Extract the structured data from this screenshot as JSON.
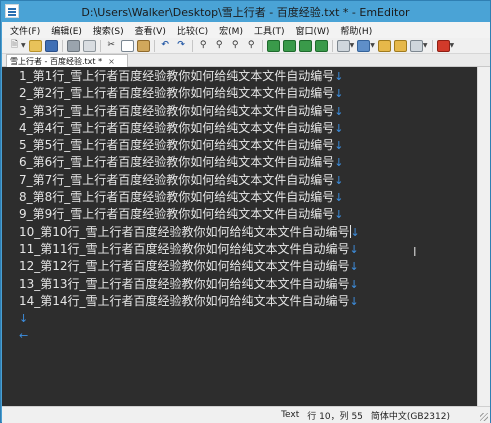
{
  "window": {
    "title": "D:\\Users\\Walker\\Desktop\\雪上行者 - 百度经验.txt * - EmEditor"
  },
  "menu": [
    {
      "label": "文件(F)"
    },
    {
      "label": "编辑(E)"
    },
    {
      "label": "搜索(S)"
    },
    {
      "label": "查看(V)"
    },
    {
      "label": "比较(C)"
    },
    {
      "label": "宏(M)"
    },
    {
      "label": "工具(T)"
    },
    {
      "label": "窗口(W)"
    },
    {
      "label": "帮助(H)"
    }
  ],
  "toolbar": {
    "icons": [
      "new-file-icon",
      "open-folder-icon",
      "save-icon",
      "print-icon",
      "print-preview-icon",
      "cut-icon",
      "copy-icon",
      "paste-icon",
      "undo-icon",
      "redo-icon",
      "find-icon",
      "find-next-icon",
      "find-prev-icon",
      "replace-icon",
      "wrap-icon",
      "view-icon",
      "outline-icon",
      "grid-icon",
      "clipboard-icon",
      "macro-icon",
      "tools-icon",
      "customize-icon",
      "stop-icon"
    ]
  },
  "tab": {
    "label": "雪上行者 - 百度经验.txt *",
    "close": "×"
  },
  "editor": {
    "eol_mark": "↓",
    "eof_mark": "←",
    "lines": [
      "1_第1行_雪上行者百度经验教你如何给纯文本文件自动编号",
      "2_第2行_雪上行者百度经验教你如何给纯文本文件自动编号",
      "3_第3行_雪上行者百度经验教你如何给纯文本文件自动编号",
      "4_第4行_雪上行者百度经验教你如何给纯文本文件自动编号",
      "5_第5行_雪上行者百度经验教你如何给纯文本文件自动编号",
      "6_第6行_雪上行者百度经验教你如何给纯文本文件自动编号",
      "7_第7行_雪上行者百度经验教你如何给纯文本文件自动编号",
      "8_第8行_雪上行者百度经验教你如何给纯文本文件自动编号",
      "9_第9行_雪上行者百度经验教你如何给纯文本文件自动编号",
      "10_第10行_雪上行者百度经验教你如何给纯文本文件自动编号",
      "11_第11行_雪上行者百度经验教你如何给纯文本文件自动编号",
      "12_第12行_雪上行者百度经验教你如何给纯文本文件自动编号",
      "13_第13行_雪上行者百度经验教你如何给纯文本文件自动编号",
      "14_第14行_雪上行者百度经验教你如何给纯文本文件自动编号"
    ],
    "cursor_line": 10
  },
  "status": {
    "mode": "Text",
    "position": "行 10，列 55",
    "encoding": "简体中文(GB2312)"
  },
  "colors": {
    "title_bg": "#4aa3d6",
    "editor_bg": "#2d2d2d",
    "editor_text": "#e6e6e6",
    "eol_mark": "#3d8fe0"
  }
}
